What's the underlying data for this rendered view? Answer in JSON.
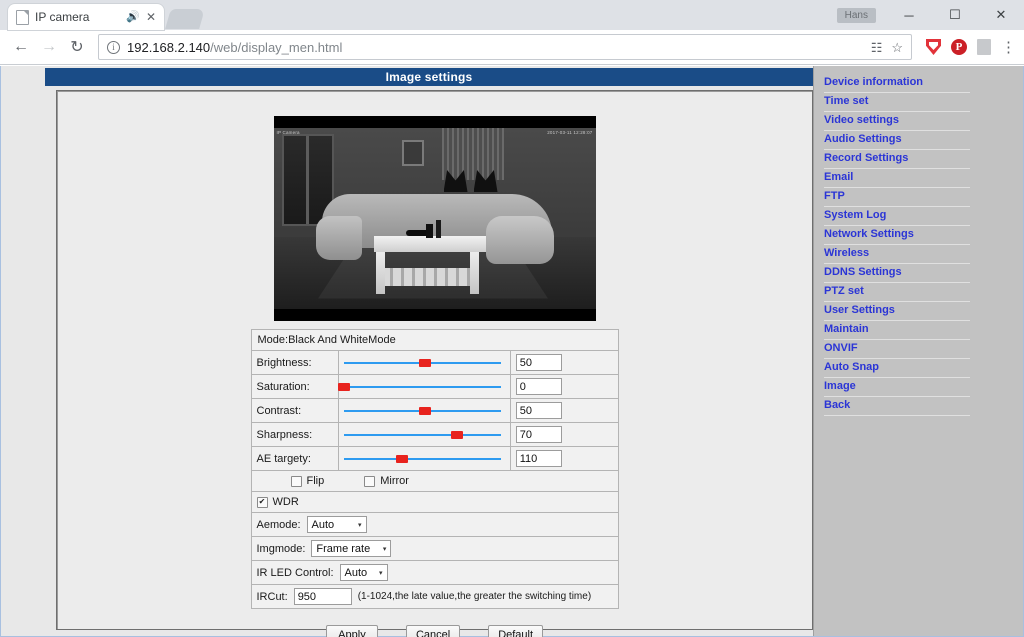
{
  "browser": {
    "tab": {
      "title": "IP camera",
      "audio_icon": "speaker-icon",
      "close_icon": "close-icon"
    },
    "profile_label": "Hans",
    "window_controls": {
      "minimize": "─",
      "maximize": "☐",
      "close": "✕"
    },
    "nav": {
      "back": "←",
      "forward": "→",
      "reload": "↻"
    },
    "omnibox": {
      "info_icon": "info-icon",
      "url_host": "192.168.2.140",
      "url_path": "/web/display_men.html",
      "translate_icon": "translate-icon",
      "bookmark_icon": "star-icon"
    },
    "extensions": [
      {
        "name": "shield-icon",
        "color": "#e2333a"
      },
      {
        "name": "pinterest-icon",
        "label": "P",
        "color": "#cb2027"
      },
      {
        "name": "pdf-icon",
        "label": "PDF",
        "color": "#c7c9cc"
      }
    ],
    "menu_icon": "⋮"
  },
  "page": {
    "title": "Image settings",
    "title_bg": "#1a4c87",
    "preview": {
      "osd_left": "IP Camera",
      "osd_right": "2017-03-11 12:28:07"
    },
    "mode_row": "Mode:Black And WhiteMode",
    "sliders": [
      {
        "label": "Brightness:",
        "value": "50",
        "percent": 50
      },
      {
        "label": "Saturation:",
        "value": "0",
        "percent": 0
      },
      {
        "label": "Contrast:",
        "value": "50",
        "percent": 50
      },
      {
        "label": "Sharpness:",
        "value": "70",
        "percent": 70
      },
      {
        "label": "AE targety:",
        "value": "110",
        "percent": 36
      }
    ],
    "checkboxes": {
      "flip": {
        "label": "Flip",
        "checked": false
      },
      "mirror": {
        "label": "Mirror",
        "checked": false
      },
      "wdr": {
        "label": "WDR",
        "checked": true
      }
    },
    "selects": [
      {
        "label": "Aemode:",
        "value": "Auto",
        "caret": "▾"
      },
      {
        "label": "Imgmode:",
        "value": "Frame rate",
        "caret": "▾"
      },
      {
        "label": "IR LED Control:",
        "value": "Auto",
        "caret": "▾"
      }
    ],
    "ircut": {
      "label": "IRCut:",
      "value": "950",
      "hint": "(1-1024,the late value,the greater the switching time)"
    },
    "buttons": {
      "apply": "Apply",
      "cancel": "Cancel",
      "default": "Default"
    },
    "sidebar": {
      "link_color": "#2b35d6",
      "items": [
        {
          "label": "Device information"
        },
        {
          "label": "Time set"
        },
        {
          "label": "Video settings"
        },
        {
          "label": "Audio Settings"
        },
        {
          "label": "Record Settings"
        },
        {
          "label": "Email"
        },
        {
          "label": "FTP"
        },
        {
          "label": "System Log"
        },
        {
          "label": "Network Settings"
        },
        {
          "label": "Wireless"
        },
        {
          "label": "DDNS Settings"
        },
        {
          "label": "PTZ set"
        },
        {
          "label": "User Settings"
        },
        {
          "label": "Maintain"
        },
        {
          "label": "ONVIF"
        },
        {
          "label": "Auto Snap"
        },
        {
          "label": "Image"
        },
        {
          "label": "Back"
        }
      ]
    }
  }
}
